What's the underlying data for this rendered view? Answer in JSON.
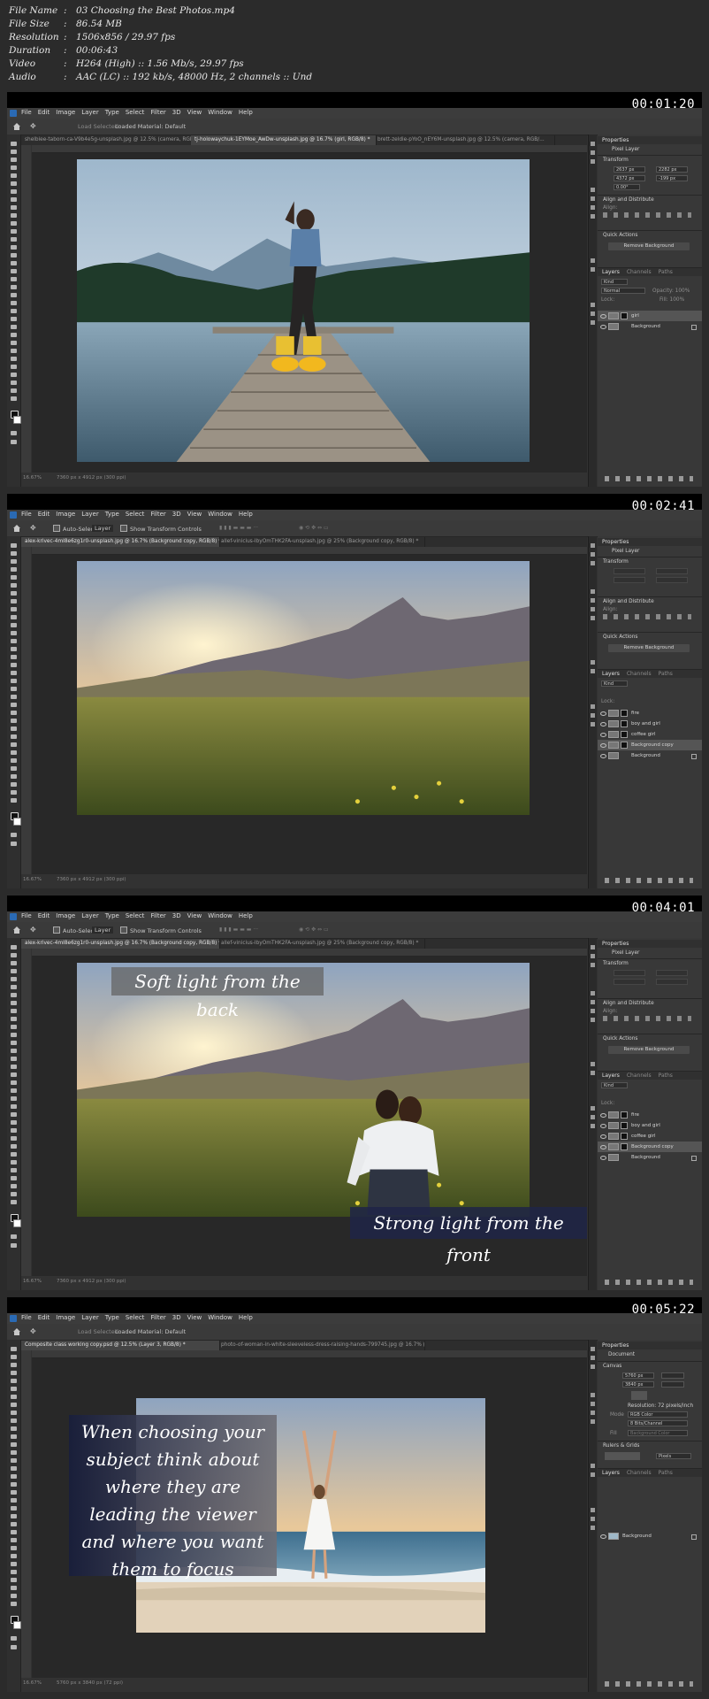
{
  "header": {
    "rows": [
      {
        "key": "File Name",
        "sep": ":",
        "value": "03 Choosing the Best Photos.mp4"
      },
      {
        "key": "File Size",
        "sep": ":",
        "value": "86.54 MB"
      },
      {
        "key": "Resolution",
        "sep": ":",
        "value": "1506x856 / 29.97 fps"
      },
      {
        "key": "Duration",
        "sep": ":",
        "value": "00:06:43"
      },
      {
        "key": "Video",
        "sep": ":",
        "value": "H264 (High) :: 1.56 Mb/s, 29.97 fps"
      },
      {
        "key": "Audio",
        "sep": ":",
        "value": "AAC (LC) :: 192 kb/s, 48000 Hz, 2 channels :: Und"
      }
    ]
  },
  "menu": [
    "File",
    "Edit",
    "Image",
    "Layer",
    "Type",
    "Select",
    "Filter",
    "3D",
    "View",
    "Window",
    "Help"
  ],
  "frames": [
    {
      "timestamp": "00:01:20",
      "options": {
        "a": "Load Selected",
        "b": "Loaded Material: Default"
      },
      "tabs": [
        "shelbiee-taborn-ca-V9b4e5g-unsplash.jpg @ 12.5% (camera, RGB/...",
        "tj-holowaychuk-1EYMoe_AwDw-unsplash.jpg @ 16.7% (girl, RGB/8) *",
        "brett-zeldie-pYoO_nEY6M-unsplash.jpg @ 12.5% (camera, RGB/..."
      ],
      "status": {
        "zoom": "16.67%",
        "doc": "7360 px x 4912 px (300 ppi)"
      },
      "panel": {
        "properties": "Properties",
        "pixel_layer": "Pixel Layer",
        "transform": "Transform",
        "w": "2637 px",
        "h": "4372 px",
        "x": "2282 px",
        "y": "-199 px",
        "angle": "0.00°",
        "align": "Align and Distribute",
        "align_sub": "Align:",
        "quick": "Quick Actions",
        "remove_bg": "Remove Background",
        "layers_tabs": [
          "Layers",
          "Channels",
          "Paths"
        ],
        "kind": "Kind",
        "blend": "Normal",
        "opacity": "Opacity: 100%",
        "lock": "Lock:",
        "fill": "Fill: 100%",
        "layers": [
          {
            "name": "girl",
            "selected": true
          },
          {
            "name": "Background",
            "selected": false
          }
        ]
      },
      "overlay": []
    },
    {
      "timestamp": "00:02:41",
      "options": {
        "a": "Auto-Select:",
        "b": "Layer",
        "c": "Show Transform Controls"
      },
      "tabs": [
        "alex-krivec-4mI8e6zg1r0-unsplash.jpg @ 16.7% (Background copy, RGB/8) *",
        "allef-vinicius-IbyOmTHK2FA-unsplash.jpg @ 25% (Background copy, RGB/8) *"
      ],
      "status": {
        "zoom": "16.67%",
        "doc": "7360 px x 4912 px (300 ppi)"
      },
      "panel": {
        "properties": "Properties",
        "pixel_layer": "Pixel Layer",
        "transform": "Transform",
        "align": "Align and Distribute",
        "align_sub": "Align:",
        "quick": "Quick Actions",
        "remove_bg": "Remove Background",
        "layers_tabs": [
          "Layers",
          "Channels",
          "Paths"
        ],
        "kind": "Kind",
        "lock": "Lock:",
        "layers": [
          {
            "name": "fire",
            "selected": false
          },
          {
            "name": "boy and girl",
            "selected": false
          },
          {
            "name": "coffee girl",
            "selected": false
          },
          {
            "name": "Background copy",
            "selected": true
          },
          {
            "name": "Background",
            "selected": false
          }
        ]
      },
      "overlay": []
    },
    {
      "timestamp": "00:04:01",
      "options": {
        "a": "Auto-Select:",
        "b": "Layer",
        "c": "Show Transform Controls"
      },
      "tabs": [
        "alex-krivec-4mI8e6zg1r0-unsplash.jpg @ 16.7% (Background copy, RGB/8) *",
        "allef-vinicius-IbyOmTHK2FA-unsplash.jpg @ 25% (Background copy, RGB/8) *"
      ],
      "status": {
        "zoom": "16.67%",
        "doc": "7360 px x 4912 px (300 ppi)"
      },
      "panel": {
        "properties": "Properties",
        "pixel_layer": "Pixel Layer",
        "transform": "Transform",
        "align": "Align and Distribute",
        "align_sub": "Align:",
        "quick": "Quick Actions",
        "remove_bg": "Remove Background",
        "layers_tabs": [
          "Layers",
          "Channels",
          "Paths"
        ],
        "kind": "Kind",
        "lock": "Lock:",
        "layers": [
          {
            "name": "fire",
            "selected": false
          },
          {
            "name": "boy and girl",
            "selected": false
          },
          {
            "name": "coffee girl",
            "selected": false
          },
          {
            "name": "Background copy",
            "selected": true
          },
          {
            "name": "Background",
            "selected": false
          }
        ]
      },
      "overlay": [
        "Soft light from the back",
        "Strong light from the front"
      ]
    },
    {
      "timestamp": "00:05:22",
      "options": {
        "a": "Load Selected",
        "b": "Loaded Material: Default"
      },
      "tabs": [
        "Composite class working copy.psd @ 12.5% (Layer 3, RGB/8) *",
        "photo-of-woman-in-white-sleeveless-dress-raising-hands-799745.jpg @ 16.7% (RGB/8)"
      ],
      "status": {
        "zoom": "16.67%",
        "doc": "5760 px x 3840 px (72 ppi)"
      },
      "panel": {
        "properties": "Properties",
        "document": "Document",
        "canvas": "Canvas",
        "w": "5760 px",
        "h": "3840 px",
        "resolution": "Resolution: 72 pixels/inch",
        "mode_label": "Mode",
        "mode": "RGB Color",
        "depth": "8 Bits/Channel",
        "fill_label": "Fill",
        "fill": "Background Color",
        "rulers": "Rulers & Grids",
        "units": "Pixels",
        "layers_tabs": [
          "Layers",
          "Channels",
          "Paths"
        ],
        "layers": [
          {
            "name": "Background",
            "selected": false
          }
        ]
      },
      "overlay": [
        "When choosing your subject think about where they are leading the viewer and where you want them to focus"
      ]
    }
  ]
}
